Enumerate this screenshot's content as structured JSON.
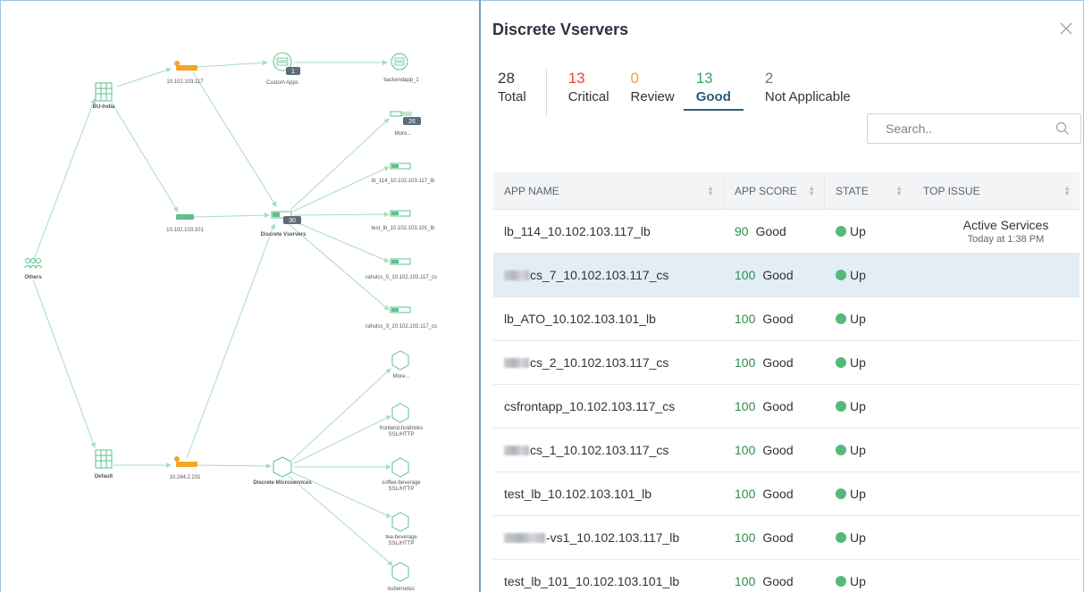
{
  "topology": {
    "nodes": {
      "bu_india": "BU-India",
      "ip117": "10.102.103.117",
      "custom_apps": "Custom Apps",
      "custom_apps_badge": "1",
      "backendapp": "backendapp_1",
      "more_top": "More...",
      "more_top_badge": "26",
      "lb114": "lb_114_10.102.103.117_lb",
      "ip101": "10.102.103.101",
      "discrete_vservers": "Discrete Vservers",
      "discrete_vservers_badge": "30",
      "test_lb": "test_lb_10.102.103.101_lb",
      "others": "Others",
      "rahulcs_5": "rahulcs_5_10.102.103.117_cs",
      "rahulcs_3": "rahulcs_3_10.102.103.117_cs",
      "more_mid": "More...",
      "frontend": "frontend-hotdrinks",
      "frontend_proto": "SSL/HTTP",
      "default": "Default",
      "ip244": "10.244.2.231",
      "discrete_micro": "Discrete Microservices",
      "coffee": "coffee-beverage",
      "coffee_proto": "SSL/HTTP",
      "tea": "tea-beverage",
      "tea_proto": "SSL/HTTP",
      "kubernetes": "kubernetes"
    },
    "colors": {
      "edge": "#a9dcc0",
      "app_node": "#5cc08a",
      "lb_node": "#f5a623"
    }
  },
  "panel": {
    "title": "Discrete Vservers",
    "close_icon": "close-icon",
    "stats": [
      {
        "num": "28",
        "label": "Total"
      },
      {
        "num": "13",
        "label": "Critical"
      },
      {
        "num": "0",
        "label": "Review"
      },
      {
        "num": "13",
        "label": "Good"
      },
      {
        "num": "2",
        "label": "Not Applicable"
      }
    ],
    "search_placeholder": "Search..",
    "table": {
      "headers": [
        "APP NAME",
        "APP SCORE",
        "STATE",
        "TOP ISSUE"
      ],
      "rows": [
        {
          "name": "lb_114_10.102.103.117_lb",
          "score": "90",
          "rating": "Good",
          "state": "Up",
          "issue": "Active Services",
          "issue_time": "Today at 1:38 PM"
        },
        {
          "name": "cs_7_10.102.103.117_cs",
          "score": "100",
          "rating": "Good",
          "state": "Up",
          "issue": "",
          "issue_time": ""
        },
        {
          "name": "lb_ATO_10.102.103.101_lb",
          "score": "100",
          "rating": "Good",
          "state": "Up",
          "issue": "",
          "issue_time": ""
        },
        {
          "name": "cs_2_10.102.103.117_cs",
          "score": "100",
          "rating": "Good",
          "state": "Up",
          "issue": "",
          "issue_time": ""
        },
        {
          "name": "csfrontapp_10.102.103.117_cs",
          "score": "100",
          "rating": "Good",
          "state": "Up",
          "issue": "",
          "issue_time": ""
        },
        {
          "name": "cs_1_10.102.103.117_cs",
          "score": "100",
          "rating": "Good",
          "state": "Up",
          "issue": "",
          "issue_time": ""
        },
        {
          "name": "test_lb_10.102.103.101_lb",
          "score": "100",
          "rating": "Good",
          "state": "Up",
          "issue": "",
          "issue_time": ""
        },
        {
          "name": "-vs1_10.102.103.117_lb",
          "score": "100",
          "rating": "Good",
          "state": "Up",
          "issue": "",
          "issue_time": ""
        },
        {
          "name": "test_lb_101_10.102.103.101_lb",
          "score": "100",
          "rating": "Good",
          "state": "Up",
          "issue": "",
          "issue_time": ""
        }
      ]
    },
    "colors": {
      "critical": "#e0483b",
      "review": "#f0a13a",
      "good": "#3aa568",
      "state_up": "#57b87a"
    }
  }
}
